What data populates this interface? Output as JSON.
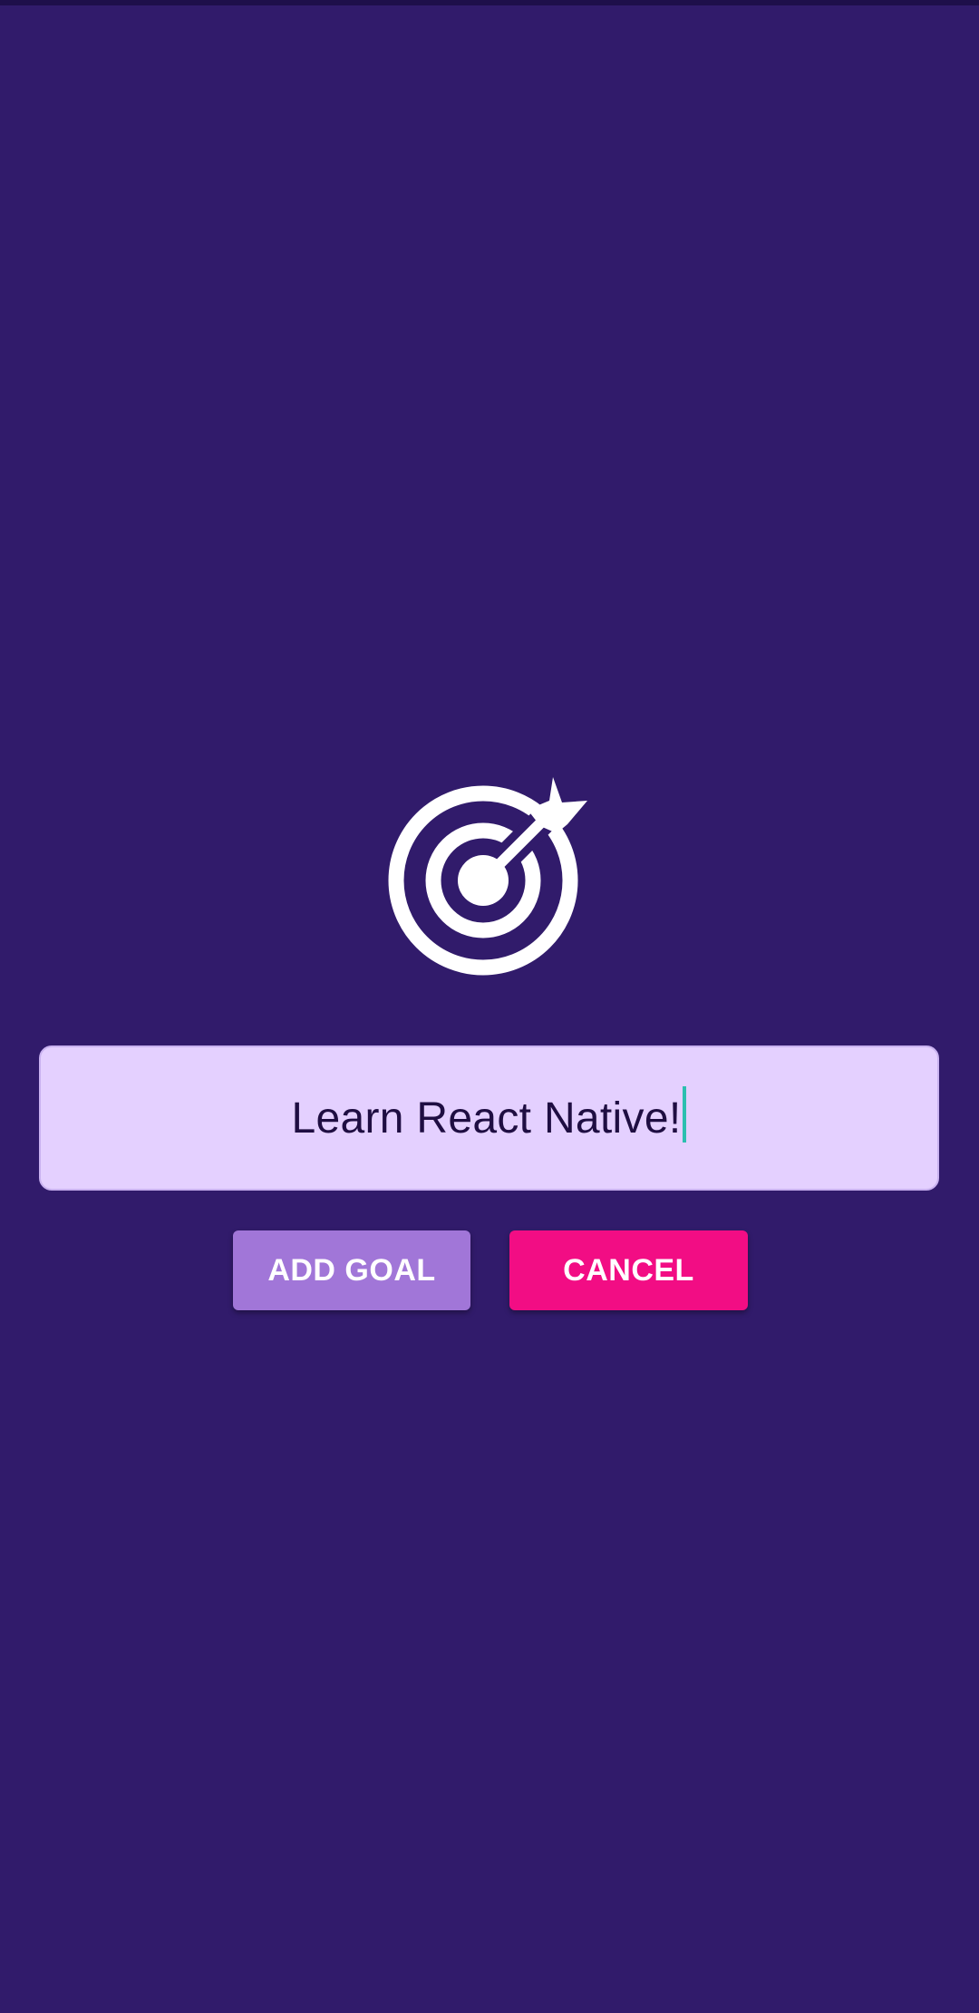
{
  "goal_input": {
    "value": "Learn React Native!"
  },
  "buttons": {
    "add_goal_label": "ADD GOAL",
    "cancel_label": "CANCEL"
  },
  "icons": {
    "main": "target-icon"
  },
  "colors": {
    "background": "#311b6b",
    "input_background": "#e4d0ff",
    "input_text": "#1f0e42",
    "cursor": "#2bbfb0",
    "add_button": "#a176d8",
    "cancel_button": "#f20d84",
    "button_text": "#ffffff"
  }
}
